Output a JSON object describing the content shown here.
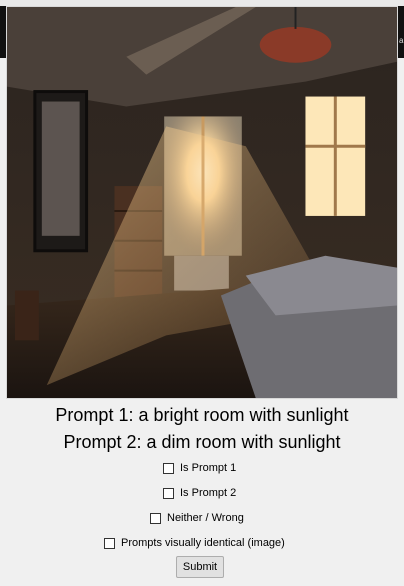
{
  "image": {
    "alt_icon": "photo-icon"
  },
  "prompts": {
    "prompt1": "Prompt 1: a bright room with sunlight",
    "prompt2": "Prompt 2: a dim room with sunlight"
  },
  "options": [
    {
      "label": "Is Prompt 1",
      "checked": false
    },
    {
      "label": "Is Prompt 2",
      "checked": false
    },
    {
      "label": "Neither / Wrong",
      "checked": false
    },
    {
      "label": "Prompts visually identical (image)",
      "checked": false
    }
  ],
  "submit_label": "Submit",
  "edge_glyph": "a"
}
